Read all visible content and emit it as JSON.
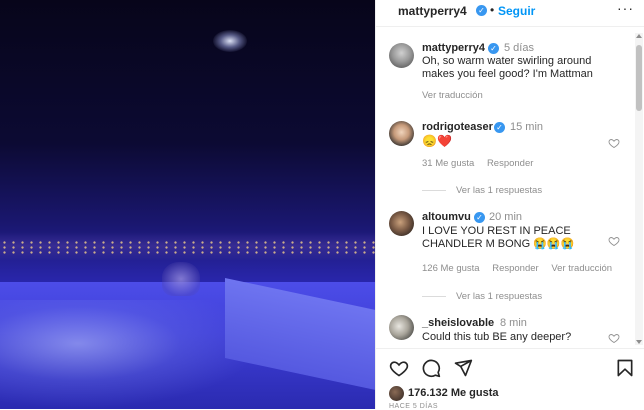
{
  "post": {
    "username": "mattyperry4",
    "follow_label": "Seguir",
    "dot": "•",
    "more_label": "···",
    "caption": {
      "username": "mattyperry4",
      "time": "5 días",
      "text": "Oh, so warm water swirling around makes you feel good? I'm Mattman",
      "translate": "Ver traducción"
    }
  },
  "comments": [
    {
      "username": "rodrigoteaser",
      "time": "15 min",
      "text": "😞❤️",
      "likes": "31 Me gusta",
      "reply": "Responder",
      "translate": "",
      "replies": "Ver las 1 respuestas"
    },
    {
      "username": "altoumvu",
      "time": "20 min",
      "text": "I LOVE YOU REST IN PEACE CHANDLER M BONG 😭😭😭",
      "likes": "126 Me gusta",
      "reply": "Responder",
      "translate": "Ver traducción",
      "replies": "Ver las 1 respuestas"
    },
    {
      "username": "_sheislovable",
      "time": "8 min",
      "text": "Could this tub BE any deeper?",
      "likes": "",
      "reply": "",
      "translate": "",
      "replies": ""
    }
  ],
  "likes": {
    "count": "176.132 Me gusta"
  },
  "time_ago": "HACE 5 DÍAS",
  "icons": {
    "verified": "verified-badge-icon",
    "like": "heart-icon",
    "comment": "comment-icon",
    "share": "paper-plane-icon",
    "save": "bookmark-icon"
  },
  "colors": {
    "accent": "#0095f6",
    "verified": "#3897f0",
    "heart": "#ed4956"
  }
}
